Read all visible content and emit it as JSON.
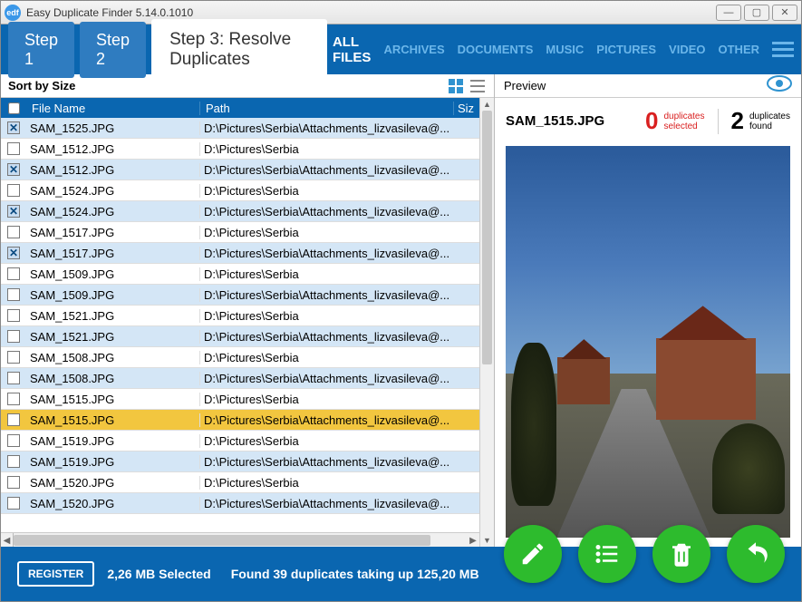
{
  "window": {
    "title": "Easy Duplicate Finder 5.14.0.1010",
    "logo_text": "edf"
  },
  "steps": {
    "step1": "Step 1",
    "step2": "Step 2",
    "step3": "Step 3: Resolve Duplicates"
  },
  "categories": [
    "ALL FILES",
    "ARCHIVES",
    "DOCUMENTS",
    "MUSIC",
    "PICTURES",
    "VIDEO",
    "OTHER"
  ],
  "sort": {
    "label": "Sort by Size"
  },
  "columns": {
    "name": "File Name",
    "path": "Path",
    "size": "Siz"
  },
  "rows": [
    {
      "name": "SAM_1525.JPG",
      "path": "D:\\Pictures\\Serbia\\Attachments_lizvasileva@...",
      "marked": true,
      "alt": true
    },
    {
      "name": "SAM_1512.JPG",
      "path": "D:\\Pictures\\Serbia",
      "marked": false,
      "alt": false
    },
    {
      "name": "SAM_1512.JPG",
      "path": "D:\\Pictures\\Serbia\\Attachments_lizvasileva@...",
      "marked": true,
      "alt": true
    },
    {
      "name": "SAM_1524.JPG",
      "path": "D:\\Pictures\\Serbia",
      "marked": false,
      "alt": false
    },
    {
      "name": "SAM_1524.JPG",
      "path": "D:\\Pictures\\Serbia\\Attachments_lizvasileva@...",
      "marked": true,
      "alt": true
    },
    {
      "name": "SAM_1517.JPG",
      "path": "D:\\Pictures\\Serbia",
      "marked": false,
      "alt": false
    },
    {
      "name": "SAM_1517.JPG",
      "path": "D:\\Pictures\\Serbia\\Attachments_lizvasileva@...",
      "marked": true,
      "alt": true
    },
    {
      "name": "SAM_1509.JPG",
      "path": "D:\\Pictures\\Serbia",
      "marked": false,
      "alt": false
    },
    {
      "name": "SAM_1509.JPG",
      "path": "D:\\Pictures\\Serbia\\Attachments_lizvasileva@...",
      "marked": false,
      "alt": true
    },
    {
      "name": "SAM_1521.JPG",
      "path": "D:\\Pictures\\Serbia",
      "marked": false,
      "alt": false
    },
    {
      "name": "SAM_1521.JPG",
      "path": "D:\\Pictures\\Serbia\\Attachments_lizvasileva@...",
      "marked": false,
      "alt": true
    },
    {
      "name": "SAM_1508.JPG",
      "path": "D:\\Pictures\\Serbia",
      "marked": false,
      "alt": false
    },
    {
      "name": "SAM_1508.JPG",
      "path": "D:\\Pictures\\Serbia\\Attachments_lizvasileva@...",
      "marked": false,
      "alt": true
    },
    {
      "name": "SAM_1515.JPG",
      "path": "D:\\Pictures\\Serbia",
      "marked": false,
      "alt": false
    },
    {
      "name": "SAM_1515.JPG",
      "path": "D:\\Pictures\\Serbia\\Attachments_lizvasileva@...",
      "marked": false,
      "alt": false,
      "selected": true
    },
    {
      "name": "SAM_1519.JPG",
      "path": "D:\\Pictures\\Serbia",
      "marked": false,
      "alt": false
    },
    {
      "name": "SAM_1519.JPG",
      "path": "D:\\Pictures\\Serbia\\Attachments_lizvasileva@...",
      "marked": false,
      "alt": true
    },
    {
      "name": "SAM_1520.JPG",
      "path": "D:\\Pictures\\Serbia",
      "marked": false,
      "alt": false
    },
    {
      "name": "SAM_1520.JPG",
      "path": "D:\\Pictures\\Serbia\\Attachments_lizvasileva@...",
      "marked": false,
      "alt": true
    }
  ],
  "preview": {
    "label": "Preview",
    "filename": "SAM_1515.JPG",
    "dup_selected_num": "0",
    "dup_selected_l1": "duplicates",
    "dup_selected_l2": "selected",
    "dup_found_num": "2",
    "dup_found_l1": "duplicates",
    "dup_found_l2": "found"
  },
  "footer": {
    "register": "REGISTER",
    "selected": "2,26 MB Selected",
    "found": "Found 39 duplicates taking up 125,20 MB"
  }
}
